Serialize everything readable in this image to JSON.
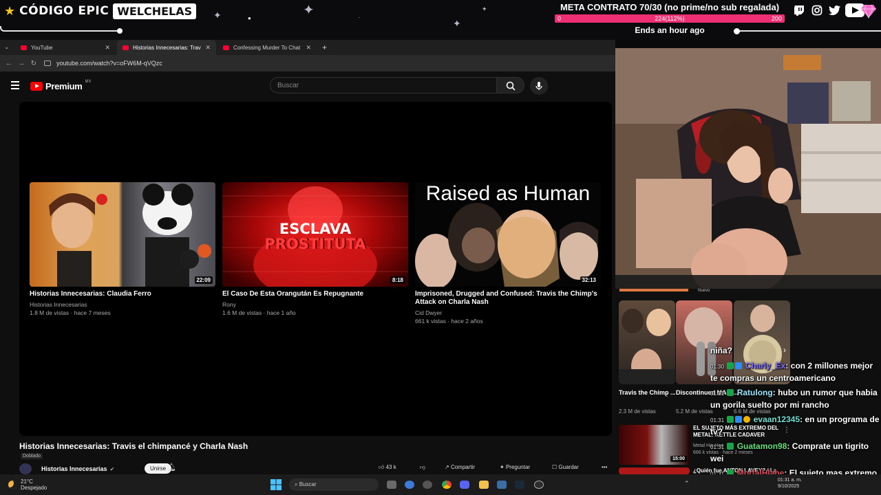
{
  "overlay": {
    "brand_name": "CÓDIGO EPIC",
    "brand_tag": "WELCHELAS",
    "meta_title": "META CONTRATO 70/30 (no prime/no sub regalada)",
    "meta_min": "0",
    "meta_current": "224(112%)",
    "meta_max": "200",
    "meta_progress": 1.0,
    "meta_ends": "Ends an hour ago",
    "accent_color": "#ee2f74",
    "socials": [
      "twitch-icon",
      "instagram-icon",
      "twitter-icon",
      "youtube-icon"
    ]
  },
  "browser": {
    "tabs": [
      {
        "label": "YouTube"
      },
      {
        "label": "Historias Innecesarias: Travis el"
      },
      {
        "label": "Confessing Murder To Chat GP"
      }
    ],
    "url": "youtube.com/watch?v=oFW6M-qVQzc"
  },
  "youtube": {
    "logo_text": "Premium",
    "logo_region": "MX",
    "search_placeholder": "Buscar",
    "end_cards": [
      {
        "title": "Historias Innecesarias: Claudia Ferro",
        "channel": "Historias Innecesarias",
        "stats": "1.8 M de vistas · hace 7 meses",
        "duration": "22:09"
      },
      {
        "title": "El Caso De Esta Orangután Es Repugnante",
        "channel": "Rony",
        "stats": "1.6 M de vistas · hace 1 año",
        "duration": "8:18",
        "thumb_text_1": "ESCLAVA",
        "thumb_text_2": "PROSTITUTA"
      },
      {
        "title": "Imprisoned, Drugged and Confused: Travis the Chimp's Attack on Charla Nash",
        "channel": "Cid Dwyer",
        "stats": "661 k vistas · hace 2 años",
        "duration": "32:13",
        "thumb_text_1": "Raised as Human"
      }
    ],
    "video_title": "Historias Innecesarias: Travis el chimpancé y Charla Nash",
    "dubbed_label": "Doblado",
    "channel_name": "Historias Innecesarias",
    "join_label": "Unirse",
    "likes": "43 k",
    "share_label": "Compartir",
    "ask_label": "Preguntar",
    "save_label": "Guardar"
  },
  "sidebar": {
    "new_label": "Nuevo",
    "shorts": [
      {
        "title": "Travis the Chimp ...",
        "views": "2.3 M de vistas"
      },
      {
        "title": "Discontinued MAC ...",
        "views": "5.2 M de vistas"
      },
      {
        "title": "",
        "views": "6.6 M de vistas"
      }
    ],
    "related": [
      {
        "title": "EL SUJETO MÁS EXTREMO DEL METAL: KETTLE CADAVER",
        "channel": "Metal Hip Hop",
        "stats": "666 k vistas · hace 2 meses",
        "duration": "15:00"
      },
      {
        "title": "¿Quién fue ANTON LAVEY? / La",
        "channel": "",
        "stats": "",
        "duration": ""
      }
    ]
  },
  "chat": {
    "messages": [
      {
        "time": "",
        "user": "",
        "text": "niña?"
      },
      {
        "time": "01:30",
        "user": "Charly_Ex",
        "text": "con 2 millones mejor te compras un centroamericano"
      },
      {
        "time": "01:31",
        "user": "Ratulong",
        "text": "hubo un rumor que habia un gorila suelto por mi rancho"
      },
      {
        "time": "01:31",
        "user": "evaan12345",
        "text": "en un programa de tv?"
      },
      {
        "time": "01:31",
        "user": "Guatamon98",
        "text": "Comprate un tigrito wei"
      },
      {
        "time": "01:31",
        "user": "MortalHlahe",
        "text": "El sujeto mas extremo del metal se ve bueno ese"
      }
    ]
  },
  "taskbar": {
    "temperature": "21°C",
    "weather": "Despejado",
    "search_label": "Buscar",
    "time": "01:31 a. m.",
    "date": "9/10/2025"
  }
}
